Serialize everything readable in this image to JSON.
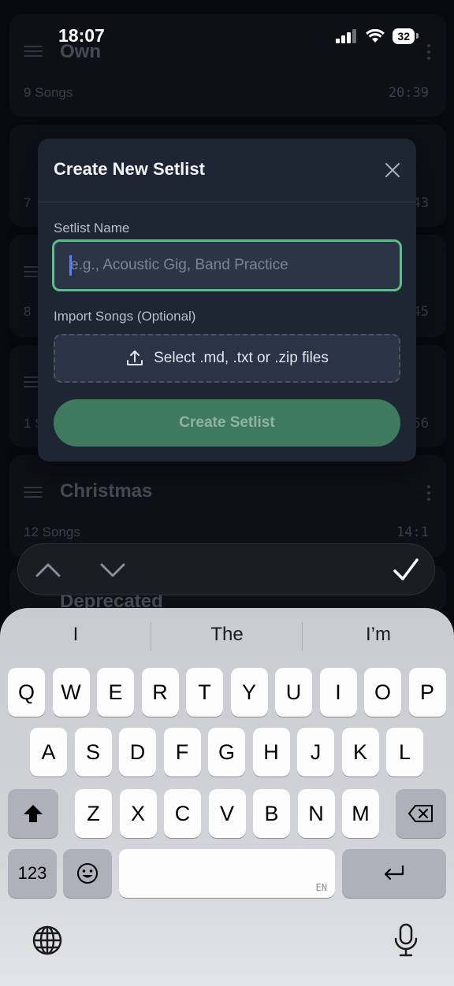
{
  "status_bar": {
    "time": "18:07",
    "battery": "32"
  },
  "background_cards": [
    {
      "title": "Own",
      "songs": "9 Songs",
      "duration": "20:39"
    },
    {
      "count_peek": "7",
      "duration_peek": "43"
    },
    {
      "count_peek": "8",
      "duration_peek": "45"
    },
    {
      "count_peek": "1 S",
      "duration_peek": "56"
    },
    {
      "title": "Christmas",
      "songs": "12 Songs",
      "duration": "14:1"
    },
    {
      "title": "Deprecated"
    }
  ],
  "modal": {
    "title": "Create New Setlist",
    "name_label": "Setlist Name",
    "name_placeholder": "e.g., Acoustic Gig, Band Practice",
    "name_value": "",
    "import_label": "Import Songs (Optional)",
    "import_button": "Select .md, .txt or .zip files",
    "create_button": "Create Setlist"
  },
  "keyboard": {
    "suggestions": [
      "I",
      "The",
      "I’m"
    ],
    "row1": [
      "Q",
      "W",
      "E",
      "R",
      "T",
      "Y",
      "U",
      "I",
      "O",
      "P"
    ],
    "row2": [
      "A",
      "S",
      "D",
      "F",
      "G",
      "H",
      "J",
      "K",
      "L"
    ],
    "row3": [
      "Z",
      "X",
      "C",
      "V",
      "B",
      "N",
      "M"
    ],
    "numbers_key": "123",
    "space_lang": "EN"
  },
  "colors": {
    "accent": "#5bbd8a",
    "button": "#3f7a5e",
    "modal_bg": "#1e2533"
  }
}
